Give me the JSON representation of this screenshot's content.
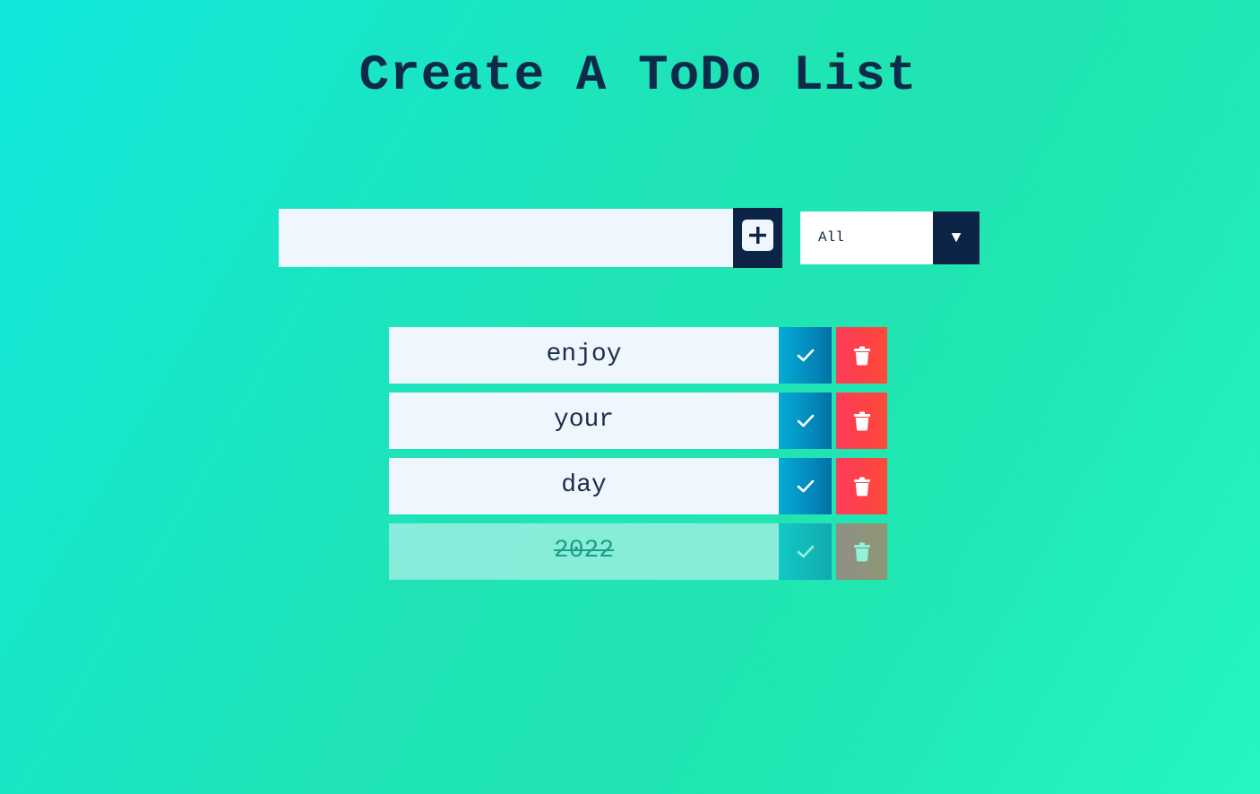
{
  "header": {
    "title": "Create A ToDo List"
  },
  "form": {
    "input_value": "",
    "input_placeholder": "",
    "add_icon": "plus-square-icon",
    "filter_selected": "All",
    "filter_arrow": "▼"
  },
  "todos": [
    {
      "text": "enjoy",
      "completed": false
    },
    {
      "text": "your",
      "completed": false
    },
    {
      "text": "day",
      "completed": false
    },
    {
      "text": "2022",
      "completed": true
    }
  ],
  "icons": {
    "complete": "check-icon",
    "delete": "trash-icon"
  },
  "colors": {
    "title": "#0d2a4a",
    "dark_button": "#0c2446",
    "check_button": "#0384b8",
    "trash_button": "#fd4344",
    "item_background": "#eff6fd"
  }
}
